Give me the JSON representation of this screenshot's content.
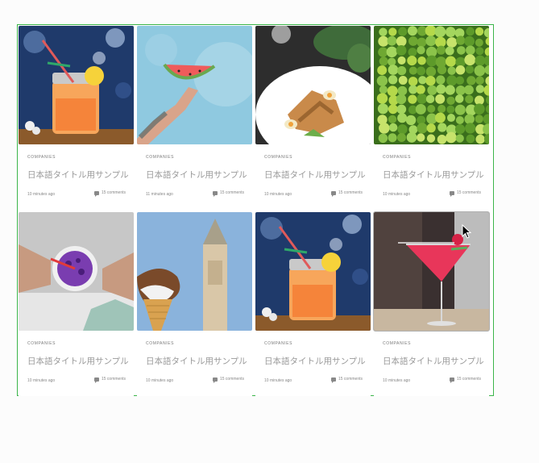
{
  "cards": [
    {
      "category": "COMPANIES",
      "title": "日本語タイトル用サンプル",
      "time": "10 minutes ago",
      "comments": "15 comments",
      "image": "orange-drink-jar"
    },
    {
      "category": "COMPANIES",
      "title": "日本語タイトル用サンプル",
      "time": "11 minutes ago",
      "comments": "15 comments",
      "image": "watermelon-hand"
    },
    {
      "category": "COMPANIES",
      "title": "日本語タイトル用サンプル",
      "time": "10 minutes ago",
      "comments": "15 comments",
      "image": "salad-plate"
    },
    {
      "category": "COMPANIES",
      "title": "日本語タイトル用サンプル",
      "time": "10 minutes ago",
      "comments": "15 comments",
      "image": "limes"
    },
    {
      "category": "COMPANIES",
      "title": "日本語タイトル用サンプル",
      "time": "10 minutes ago",
      "comments": "15 comments",
      "image": "berry-smoothie"
    },
    {
      "category": "COMPANIES",
      "title": "日本語タイトル用サンプル",
      "time": "10 minutes ago",
      "comments": "15 comments",
      "image": "ice-cream-cone"
    },
    {
      "category": "COMPANIES",
      "title": "日本語タイトル用サンプル",
      "time": "10 minutes ago",
      "comments": "15 comments",
      "image": "orange-drink-jar"
    },
    {
      "category": "COMPANIES",
      "title": "日本語タイトル用サンプル",
      "time": "10 minutes ago",
      "comments": "15 comments",
      "image": "cocktail-glass"
    }
  ],
  "colors": {
    "frame_border": "#3bb54a",
    "title": "#9a9a9a",
    "meta": "#888888"
  }
}
